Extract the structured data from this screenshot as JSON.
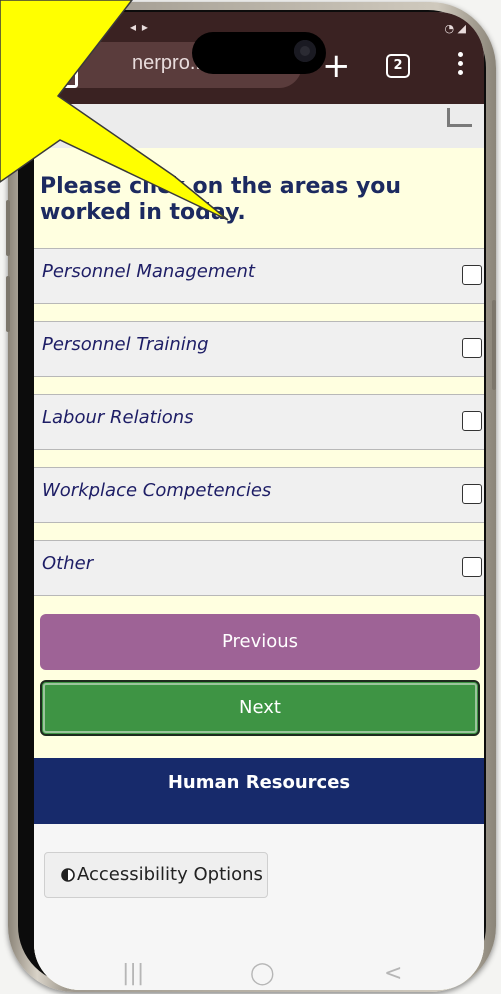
{
  "browser": {
    "url_fragment": "nerpro...com",
    "tab_count": "2"
  },
  "page": {
    "heading": "Please click on the areas you worked in today.",
    "options": [
      {
        "label": "Personnel Management",
        "checked": false
      },
      {
        "label": "Personnel Training",
        "checked": false
      },
      {
        "label": "Labour Relations",
        "checked": false
      },
      {
        "label": "Workplace Competencies",
        "checked": false
      },
      {
        "label": "Other",
        "checked": false
      }
    ],
    "previous_label": "Previous",
    "next_label": "Next",
    "footer_title": "Human Resources",
    "accessibility_label": "Accessibility Options"
  },
  "colors": {
    "page_bg": "#ffffe0",
    "heading": "#1c2a60",
    "previous_button": "#9e6396",
    "next_button": "#3e9444",
    "footer_bar": "#172a6b",
    "browser_bar": "#3a2222",
    "callout": "#ffff00"
  }
}
